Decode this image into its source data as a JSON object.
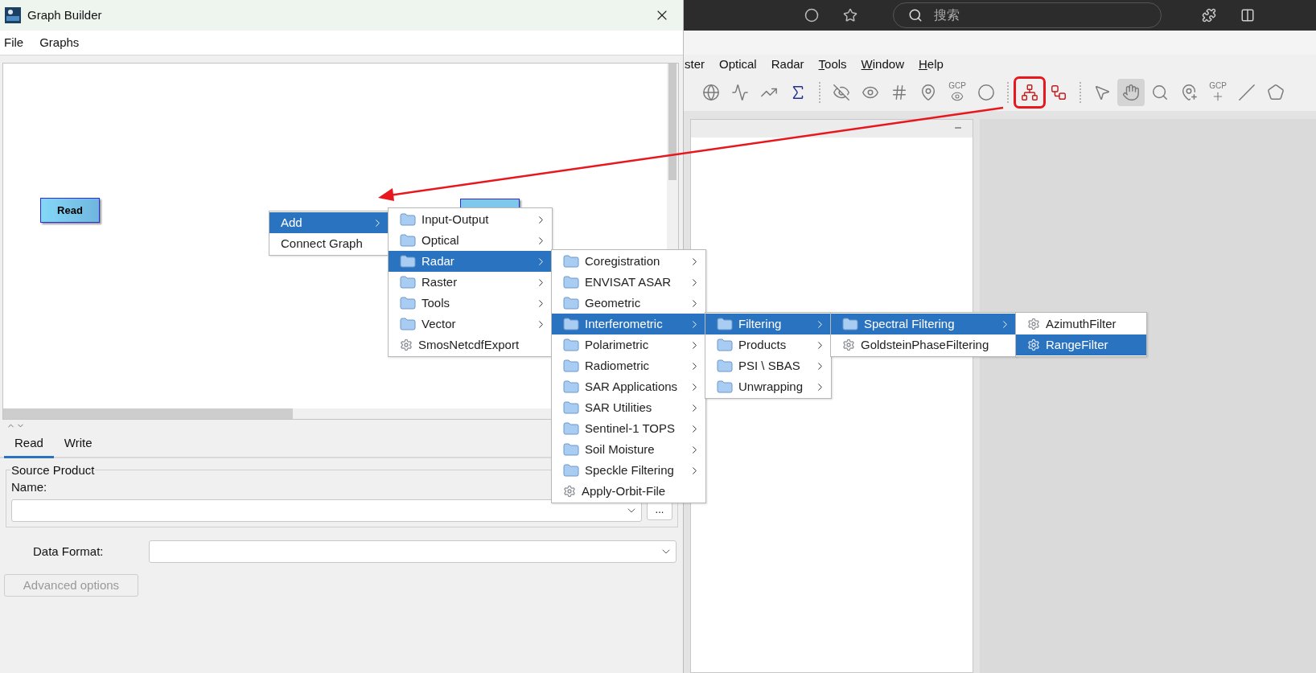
{
  "browser": {
    "search_placeholder": "搜索"
  },
  "app_menubar": [
    {
      "label": "ster",
      "mnemonic": false
    },
    {
      "label": "Optical",
      "mnemonic": false
    },
    {
      "label": "Radar",
      "mnemonic": false
    },
    {
      "label": "Tools",
      "mnemonic": true
    },
    {
      "label": "Window",
      "mnemonic": true
    },
    {
      "label": "Help",
      "mnemonic": true
    }
  ],
  "toolbar": [
    {
      "kind": "globe",
      "selected": false,
      "marked": false
    },
    {
      "kind": "spectrum",
      "selected": false,
      "marked": false
    },
    {
      "kind": "scatter",
      "selected": false,
      "marked": false
    },
    {
      "kind": "sigma",
      "selected": false,
      "marked": false
    },
    {
      "kind": "separator"
    },
    {
      "kind": "eyeoff",
      "selected": false,
      "marked": false
    },
    {
      "kind": "eye",
      "selected": false,
      "marked": false
    },
    {
      "kind": "grid",
      "selected": false,
      "marked": false
    },
    {
      "kind": "pin",
      "selected": false,
      "marked": false
    },
    {
      "kind": "gcp",
      "label": "GCP",
      "selected": false,
      "marked": false
    },
    {
      "kind": "blob",
      "selected": false,
      "marked": false
    },
    {
      "kind": "separator"
    },
    {
      "kind": "graph",
      "selected": false,
      "marked": true
    },
    {
      "kind": "batch",
      "selected": false,
      "marked": false
    },
    {
      "kind": "separator"
    },
    {
      "kind": "pointer",
      "selected": false,
      "marked": false
    },
    {
      "kind": "hand",
      "selected": true,
      "marked": false
    },
    {
      "kind": "zoom",
      "selected": false,
      "marked": false
    },
    {
      "kind": "pinadd",
      "selected": false,
      "marked": false
    },
    {
      "kind": "gcpadd",
      "label": "GCP",
      "selected": false,
      "marked": false
    },
    {
      "kind": "line",
      "selected": false,
      "marked": false
    },
    {
      "kind": "polygon",
      "selected": false,
      "marked": false
    }
  ],
  "graph_builder": {
    "title": "Graph Builder",
    "menus": [
      "File",
      "Graphs"
    ],
    "nodes": [
      {
        "label": "Read",
        "covered": false
      },
      {
        "covered": true
      }
    ],
    "tabs": [
      {
        "label": "Read",
        "selected": true
      },
      {
        "label": "Write",
        "selected": false
      }
    ],
    "source_product": {
      "legend": "Source Product",
      "name_label": "Name:",
      "browse_button": "..."
    },
    "data_format_label": "Data Format:",
    "advanced_button": {
      "label": "Advanced options",
      "disabled": true
    }
  },
  "context_menu": [
    {
      "kind": "submenu",
      "label": "Add",
      "selected": true,
      "children": [
        {
          "kind": "folder",
          "label": "Input-Output",
          "selected": false
        },
        {
          "kind": "folder",
          "label": "Optical",
          "selected": false
        },
        {
          "kind": "folder",
          "label": "Radar",
          "selected": true,
          "children": [
            {
              "kind": "folder",
              "label": "Coregistration",
              "selected": false
            },
            {
              "kind": "folder",
              "label": "ENVISAT ASAR",
              "selected": false
            },
            {
              "kind": "folder",
              "label": "Geometric",
              "selected": false
            },
            {
              "kind": "folder",
              "label": "Interferometric",
              "selected": true,
              "children": [
                {
                  "kind": "folder",
                  "label": "Filtering",
                  "selected": true,
                  "children": [
                    {
                      "kind": "folder",
                      "label": "Spectral Filtering",
                      "selected": true,
                      "children": [
                        {
                          "kind": "operator",
                          "label": "AzimuthFilter",
                          "selected": false
                        },
                        {
                          "kind": "operator",
                          "label": "RangeFilter",
                          "selected": true
                        }
                      ]
                    },
                    {
                      "kind": "operator",
                      "label": "GoldsteinPhaseFiltering",
                      "selected": false
                    }
                  ]
                },
                {
                  "kind": "folder",
                  "label": "Products",
                  "selected": false
                },
                {
                  "kind": "folder",
                  "label": "PSI \\ SBAS",
                  "selected": false
                },
                {
                  "kind": "folder",
                  "label": "Unwrapping",
                  "selected": false
                }
              ]
            },
            {
              "kind": "folder",
              "label": "Polarimetric",
              "selected": false
            },
            {
              "kind": "folder",
              "label": "Radiometric",
              "selected": false
            },
            {
              "kind": "folder",
              "label": "SAR Applications",
              "selected": false
            },
            {
              "kind": "folder",
              "label": "SAR Utilities",
              "selected": false
            },
            {
              "kind": "folder",
              "label": "Sentinel-1 TOPS",
              "selected": false
            },
            {
              "kind": "folder",
              "label": "Soil Moisture",
              "selected": false
            },
            {
              "kind": "folder",
              "label": "Speckle Filtering",
              "selected": false
            },
            {
              "kind": "operator",
              "label": "Apply-Orbit-File",
              "selected": false
            }
          ]
        },
        {
          "kind": "folder",
          "label": "Raster",
          "selected": false
        },
        {
          "kind": "folder",
          "label": "Tools",
          "selected": false
        },
        {
          "kind": "folder",
          "label": "Vector",
          "selected": false
        },
        {
          "kind": "operator",
          "label": "SmosNetcdfExport",
          "selected": false
        }
      ]
    },
    {
      "kind": "action",
      "label": "Connect Graph",
      "selected": false
    }
  ]
}
